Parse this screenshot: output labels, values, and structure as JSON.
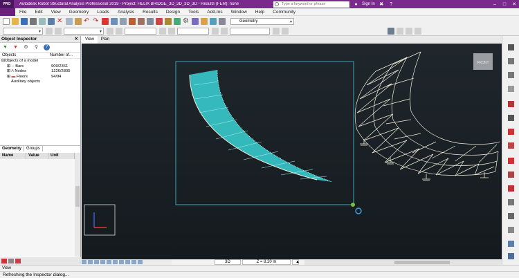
{
  "title_bar": {
    "logo": "PRO",
    "title": "Autodesk Robot Structural Analysis Professional 2019 - Project: HELIX BRIDGE_3D_3D_3D_3D - Results (FEM): none",
    "search_placeholder": "Type a keyword or phrase",
    "signin": "Sign In"
  },
  "menu": [
    "File",
    "Edit",
    "View",
    "Geometry",
    "Loads",
    "Analysis",
    "Results",
    "Design",
    "Tools",
    "Add-Ins",
    "Window",
    "Help",
    "Community"
  ],
  "layout_combo": "Geometry",
  "inspector": {
    "title": "Object Inspector",
    "columns": [
      "Objects",
      "Number of..."
    ],
    "tree": [
      {
        "name": "Objects of a model",
        "value": ""
      },
      {
        "name": "Bars",
        "value": "900/2361"
      },
      {
        "name": "Nodes",
        "value": "1226/2805"
      },
      {
        "name": "Floors",
        "value": "94/94"
      },
      {
        "name": "Auxiliary objects",
        "value": ""
      }
    ],
    "tabs": [
      "Geometry",
      "Groups"
    ],
    "grid_columns": [
      "Name",
      "Value",
      "Unit"
    ]
  },
  "view_tabs": [
    "View",
    "Plan"
  ],
  "viewcube_label": "FRONT",
  "viewport_status": {
    "mode": "3D",
    "z_level": "Z = 8.20 m"
  },
  "view_bar_label": "View",
  "status_text": "Refreshing the Inspector dialog...",
  "colors": {
    "title_bar": "#7a2a8c",
    "viewport_bg": "#1a2125",
    "bridge_cyan": "#39d4d6",
    "wire_white": "#f2f0dd",
    "selection_frame": "#3aa7b4"
  }
}
